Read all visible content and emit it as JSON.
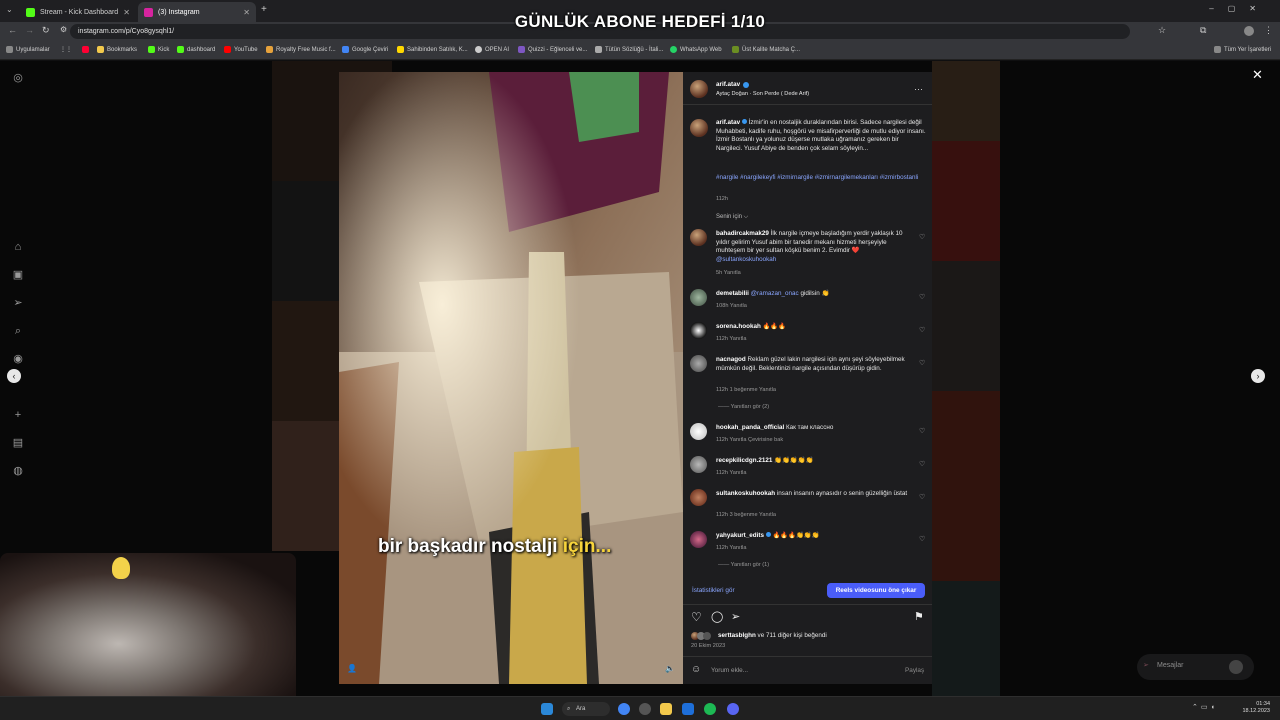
{
  "overlay": {
    "title": "GÜNLÜK ABONE HEDEFİ 1/10"
  },
  "browser": {
    "tabs": [
      {
        "label": "Stream - Kick Dashboard",
        "active": false,
        "color": "#53fc18"
      },
      {
        "label": "(3) Instagram",
        "active": true,
        "color": "#d6249f"
      }
    ],
    "url": "instagram.com/p/Cyo8gysqhl1/",
    "bookmarks": [
      {
        "label": "Uygulamalar",
        "color": "#888888"
      },
      {
        "label": "Bookmarks",
        "color": "#f2c94c"
      },
      {
        "label": "Kick",
        "color": "#53fc18"
      },
      {
        "label": "dashboard",
        "color": "#53fc18"
      },
      {
        "label": "YouTube",
        "color": "#ff0000"
      },
      {
        "label": "Royalty Free Music f...",
        "color": "#e6a23c"
      },
      {
        "label": "Google Çeviri",
        "color": "#4285f4"
      },
      {
        "label": "Sahibinden Satılık, K...",
        "color": "#ffd800"
      },
      {
        "label": "OPEN AI",
        "color": "#cccccc"
      },
      {
        "label": "Quizzi - Eğlenceli ve...",
        "color": "#7e57c2"
      },
      {
        "label": "Tütün Sözlüğü - İtali...",
        "color": "#aaaaaa"
      },
      {
        "label": "WhatsApp Web",
        "color": "#25d366"
      },
      {
        "label": "Üst Kalite Matcha Ç...",
        "color": "#6b8e23"
      }
    ],
    "all_bookmarks": "Tüm Yer İşaretleri"
  },
  "post": {
    "author": "arif.atav",
    "audio": "Aytaç Doğan · Son Perde ( Dede Arif)",
    "caption_user": "arif.atav",
    "caption_text": "İzmir'in en nostaljik duraklarından birisi. Sadece nargilesi değil Muhabbeti, kadife ruhu, hoşgörü ve misafirperverliği de mutlu ediyor insanı. İzmir Bostanlı ya yolunuz düşerse mutlaka uğramanız gereken bir Nargileci. Yusuf Abiye de benden çok selam söyleyin...",
    "hashtags": "#nargile #nargilekeyfi #izmirnargile #izmirnargilemekanları #izmirbostanli",
    "caption_time": "112h",
    "filter_label": "Senin için ⌵",
    "video_caption_white": "bir başkadır nostalji ",
    "video_caption_yellow": "için...",
    "likes_user": "serttasblghn",
    "likes_text": " ve 711 diğer kişi beğendi",
    "date": "20 Ekim 2023",
    "comment_placeholder": "Yorum ekle...",
    "share_label": "Paylaş",
    "stats_link": "İstatistikleri gör",
    "reels_button": "Reels videosunu öne çıkar"
  },
  "comments": [
    {
      "user": "bahadircakmak29",
      "text": "İlk nargile içmeye başladığım yerdir yaklaşık 10 yıldır gelirim Yusuf abim bir tanedir mekanı hizmeti herşeyiyle muhteşem bir yer sultan köşkü benim 2. Evimdir ❤️ ",
      "mention": "@sultankoskuhookah",
      "meta": "5h   Yanıtla"
    },
    {
      "user": "demetabilii",
      "mention": "@ramazan_onac",
      "text": " gidilsin 👏",
      "meta": "108h   Yanıtla"
    },
    {
      "user": "sorena.hookah",
      "text": "🔥🔥🔥",
      "meta": "112h   Yanıtla"
    },
    {
      "user": "nacnagod",
      "text": "Reklam güzel lakin nargilesi için aynı şeyi söyleyebilmek mümkün değil. Beklentinizi nargile açısından düşürüp gidin.",
      "meta": "112h   1 beğenme   Yanıtla",
      "replies": "Yanıtları gör (2)"
    },
    {
      "user": "hookah_panda_official",
      "text": "Как там классно",
      "meta": "112h   Yanıtla   Çevirisine bak"
    },
    {
      "user": "recepkilicdgn.2121",
      "text": "👏👏👏👏👏",
      "meta": "112h   Yanıtla"
    },
    {
      "user": "sultankoskuhookah",
      "text": "insan insanın aynasıdır o senin güzelliğin üstat",
      "meta": "112h   3 beğenme   Yanıtla"
    },
    {
      "user": "yahyakurt_edits",
      "text": "🔥🔥🔥👏👏👏",
      "meta": "112h   Yanıtla",
      "replies": "Yanıtları gör (1)"
    }
  ],
  "messages_pill": "Mesajlar",
  "taskbar": {
    "search": "Ara",
    "time": "01:34",
    "date": "18.12.2023"
  }
}
